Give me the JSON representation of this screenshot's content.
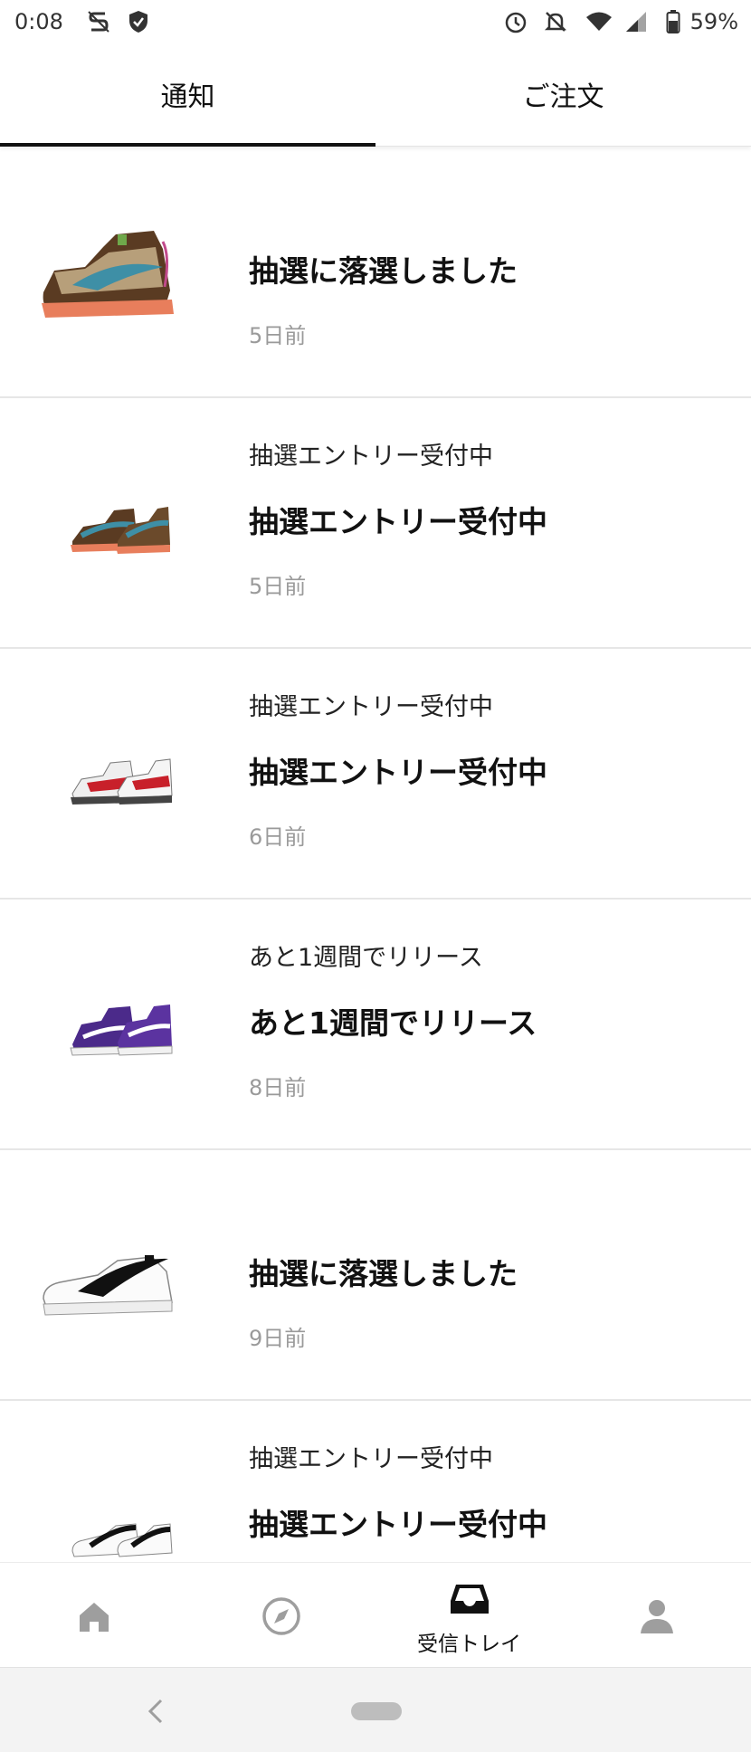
{
  "status_bar": {
    "time": "0:08",
    "battery": "59%",
    "icons": [
      "s-app-icon",
      "shield-icon",
      "alarm-icon",
      "notifications-off-icon",
      "wifi-icon",
      "signal-icon",
      "battery-icon"
    ]
  },
  "tabs": [
    {
      "label": "通知",
      "active": true
    },
    {
      "label": "ご注文",
      "active": false
    }
  ],
  "notifications": [
    {
      "subtitle": "",
      "title": "抽選に落選しました",
      "time": "5日前",
      "image": "sneaker-dunk-high-brown"
    },
    {
      "subtitle": "抽選エントリー受付中",
      "title": "抽選エントリー受付中",
      "time": "5日前",
      "image": "sneaker-pair-dunk-brown"
    },
    {
      "subtitle": "抽選エントリー受付中",
      "title": "抽選エントリー受付中",
      "time": "6日前",
      "image": "sneaker-pair-jordan-red-white"
    },
    {
      "subtitle": "あと1週間でリリース",
      "title": "あと1週間でリリース",
      "time": "8日前",
      "image": "sneaker-pair-dunk-purple"
    },
    {
      "subtitle": "",
      "title": "抽選に落選しました",
      "time": "9日前",
      "image": "sneaker-af1-white-black"
    },
    {
      "subtitle": "抽選エントリー受付中",
      "title": "抽選エントリー受付中",
      "time": "",
      "image": "sneaker-pair-af1-white-black"
    }
  ],
  "bottom_nav": {
    "items": [
      {
        "icon": "home-icon",
        "label": ""
      },
      {
        "icon": "compass-icon",
        "label": ""
      },
      {
        "icon": "inbox-icon",
        "label": "受信トレイ"
      },
      {
        "icon": "profile-icon",
        "label": ""
      }
    ]
  },
  "colors": {
    "text": "#111111",
    "muted": "#9a9a9a",
    "divider": "#e6e6e6",
    "icon_inactive": "#9e9e9e"
  }
}
